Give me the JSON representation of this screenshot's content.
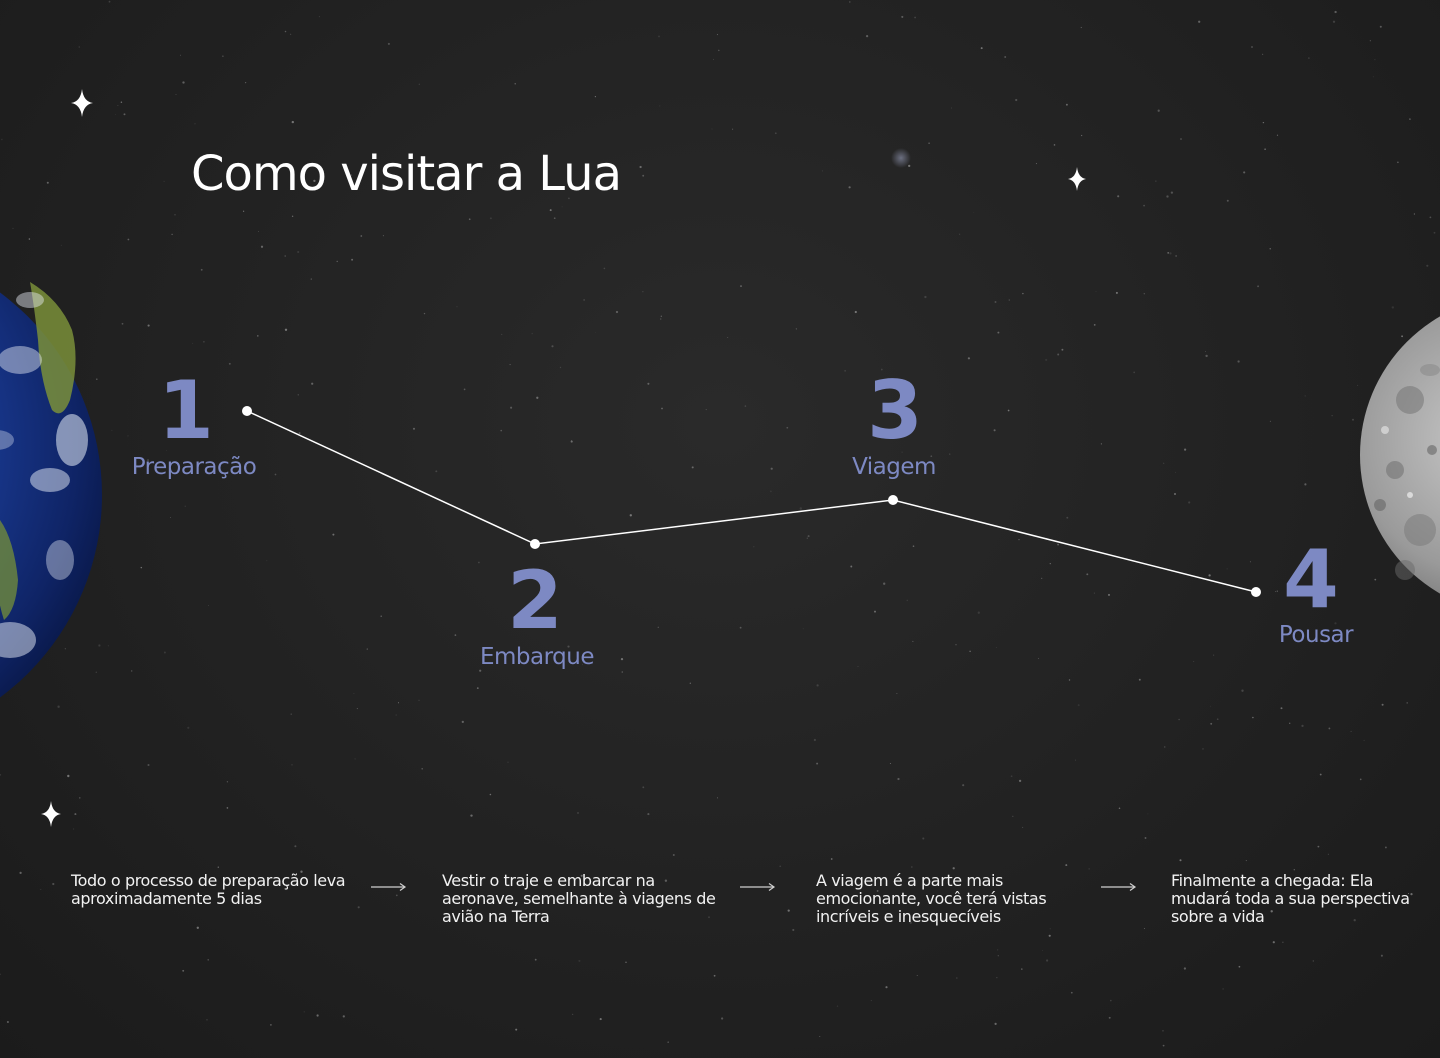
{
  "title": "Como visitar a Lua",
  "steps": [
    {
      "number": "1",
      "label": "Preparação",
      "description": "Todo o processo de preparação leva aproximadamente 5 dias"
    },
    {
      "number": "2",
      "label": "Embarque",
      "description": "Vestir o traje e embarcar na aeronave, semelhante à viagens de avião na Terra"
    },
    {
      "number": "3",
      "label": "Viagem",
      "description": "A viagem é a parte mais emocionante, você terá vistas incríveis e inesquecíveis"
    },
    {
      "number": "4",
      "label": "Pousar",
      "description": "Finalmente a chegada: Ela mudará toda a sua perspectiva sobre a vida"
    }
  ],
  "colors": {
    "background": "#232323",
    "accent": "#7d89c3",
    "text": "#ffffff",
    "connector": "#ffffff"
  },
  "icons": {
    "sparkle": "four-point-star-icon",
    "arrow": "long-right-arrow-icon",
    "earth": "earth-planet",
    "moon": "moon"
  }
}
